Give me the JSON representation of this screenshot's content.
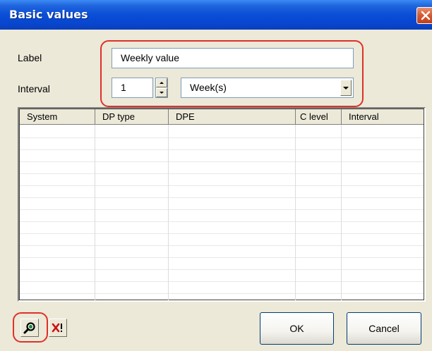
{
  "window": {
    "title": "Basic values"
  },
  "form": {
    "label_caption": "Label",
    "label_value": "Weekly value",
    "interval_caption": "Interval",
    "interval_value": "1",
    "interval_unit": "Week(s)"
  },
  "table": {
    "columns": [
      "System",
      "DP type",
      "DPE",
      "C level",
      "Interval"
    ],
    "rows": []
  },
  "buttons": {
    "ok": "OK",
    "cancel": "Cancel"
  },
  "icons": {
    "search": "search-icon",
    "delete": "delete-x-icon",
    "close": "close-icon"
  },
  "colors": {
    "titlebar": "#0a4ed6",
    "highlight": "#e0302a",
    "dialog_bg": "#ece9d8"
  }
}
